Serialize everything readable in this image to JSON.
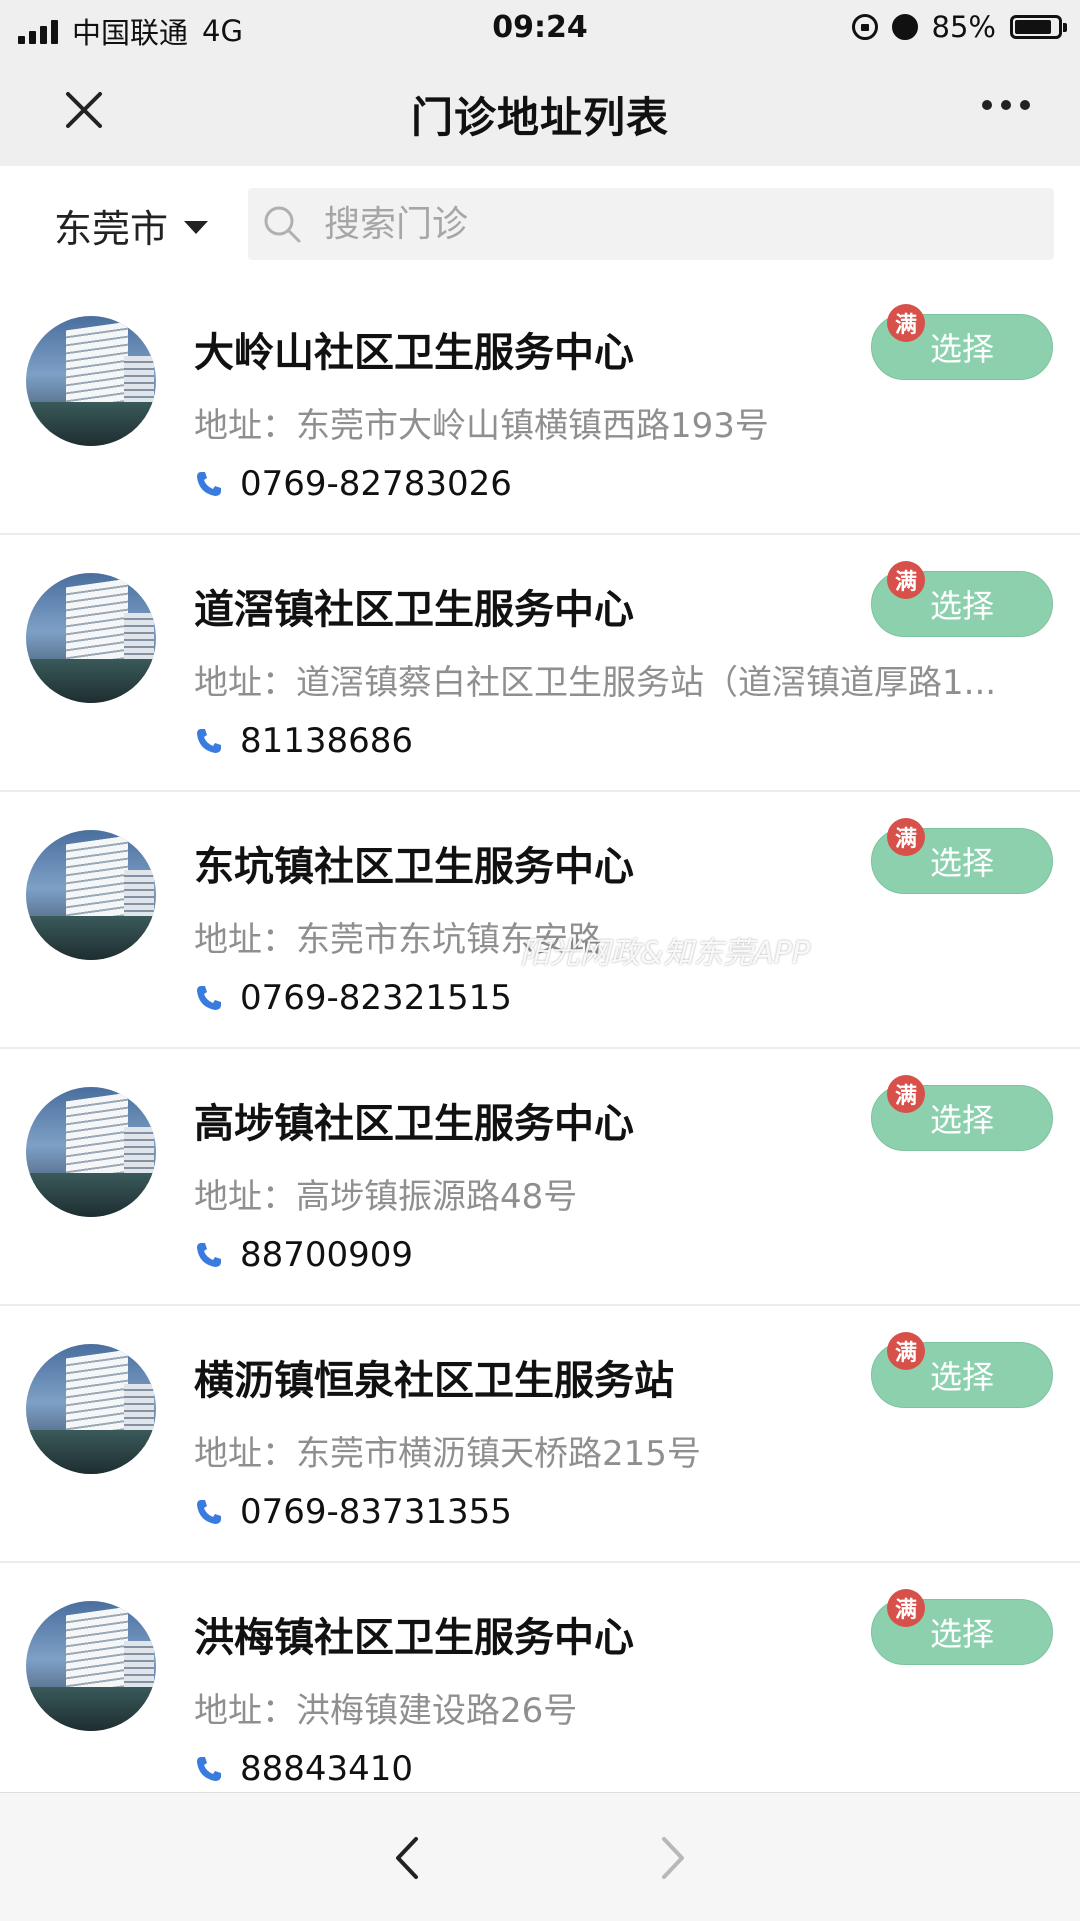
{
  "status_bar": {
    "carrier": "中国联通",
    "network": "4G",
    "time": "09:24",
    "battery": "85%",
    "battery_level": 0.85
  },
  "nav": {
    "title": "门诊地址列表",
    "close_icon": "close-icon",
    "more_icon": "more-icon"
  },
  "filter": {
    "city": "东莞市",
    "search_placeholder": "搜索门诊",
    "search_value": ""
  },
  "clinics": [
    {
      "name": "大岭山社区卫生服务中心",
      "address_label": "地址：",
      "address": "东莞市大岭山镇横镇西路193号",
      "phone": "0769-82783026",
      "badge": "满",
      "button": "选择"
    },
    {
      "name": "道滘镇社区卫生服务中心",
      "address_label": "地址：",
      "address": "道滘镇蔡白社区卫生服务站（道滘镇道厚路1...",
      "phone": "81138686",
      "badge": "满",
      "button": "选择"
    },
    {
      "name": "东坑镇社区卫生服务中心",
      "address_label": "地址：",
      "address": "东莞市东坑镇东安路",
      "phone": "0769-82321515",
      "badge": "满",
      "button": "选择"
    },
    {
      "name": "高埗镇社区卫生服务中心",
      "address_label": "地址：",
      "address": "高埗镇振源路48号",
      "phone": "88700909",
      "badge": "满",
      "button": "选择"
    },
    {
      "name": "横沥镇恒泉社区卫生服务站",
      "address_label": "地址：",
      "address": "东莞市横沥镇天桥路215号",
      "phone": "0769-83731355",
      "badge": "满",
      "button": "选择"
    },
    {
      "name": "洪梅镇社区卫生服务中心",
      "address_label": "地址：",
      "address": "洪梅镇建设路26号",
      "phone": "88843410",
      "badge": "满",
      "button": "选择"
    }
  ],
  "watermark": "阳光网政&知东莞APP",
  "colors": {
    "accent_green": "#8dd0ae",
    "badge_red": "#d8504a",
    "phone_blue": "#3a7be0"
  },
  "toolbar": {
    "back_icon": "chevron-left-icon",
    "forward_icon": "chevron-right-icon"
  }
}
